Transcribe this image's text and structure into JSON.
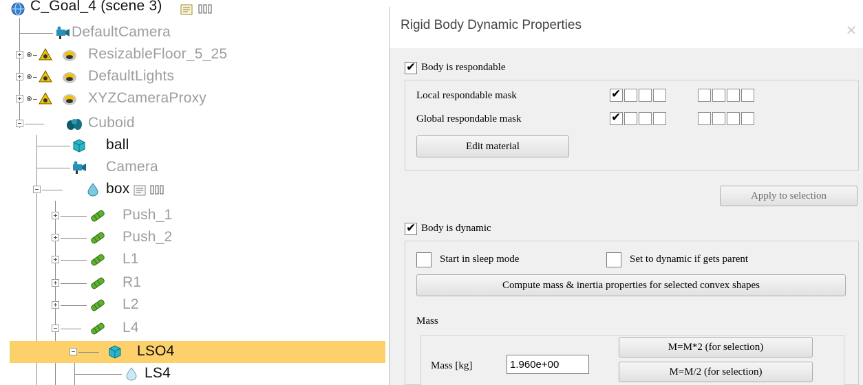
{
  "tree": {
    "root": {
      "label": "C_Goal_4 (scene 3)"
    },
    "items": [
      {
        "label": "DefaultCamera"
      },
      {
        "label": "ResizableFloor_5_25"
      },
      {
        "label": "DefaultLights"
      },
      {
        "label": "XYZCameraProxy"
      },
      {
        "label": "Cuboid"
      },
      {
        "label": "ball"
      },
      {
        "label": "Camera"
      },
      {
        "label": "box"
      },
      {
        "label": "Push_1"
      },
      {
        "label": "Push_2"
      },
      {
        "label": "L1"
      },
      {
        "label": "R1"
      },
      {
        "label": "L2"
      },
      {
        "label": "L4"
      },
      {
        "label": "LSO4"
      },
      {
        "label": "LS4"
      }
    ]
  },
  "dialog": {
    "title": "Rigid Body Dynamic Properties",
    "respondable": {
      "label": "Body is respondable",
      "checked": true,
      "local_mask_label": "Local respondable mask",
      "global_mask_label": "Global respondable mask",
      "local_mask": [
        true,
        false,
        false,
        false,
        false,
        false,
        false,
        false
      ],
      "global_mask": [
        true,
        false,
        false,
        false,
        false,
        false,
        false,
        false
      ],
      "edit_material_label": "Edit material"
    },
    "apply_to_selection_label": "Apply to selection",
    "dynamic": {
      "label": "Body is dynamic",
      "checked": true,
      "sleep_label": "Start in sleep mode",
      "sleep_checked": false,
      "set_dynamic_label": "Set to dynamic if gets parent",
      "set_dynamic_checked": false,
      "compute_label": "Compute mass & inertia properties for selected convex shapes"
    },
    "mass": {
      "section_label": "Mass",
      "field_label": "Mass [kg]",
      "value": "1.960e+00",
      "double_label": "M=M*2  (for selection)",
      "half_label": "M=M/2  (for selection)"
    }
  },
  "colors": {
    "selection": "#fcd16c",
    "dimmed_text": "#9d9d9d",
    "dialog_bg": "#f0f0f0"
  }
}
